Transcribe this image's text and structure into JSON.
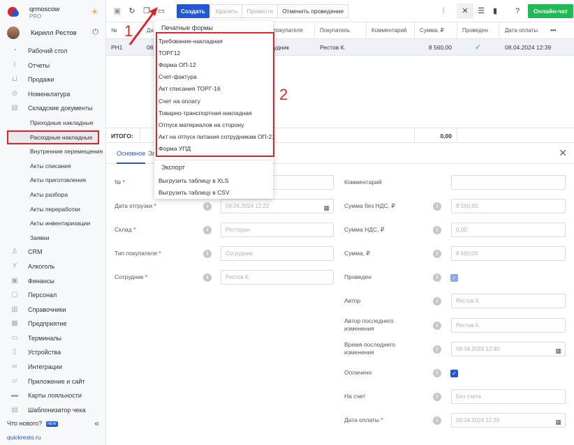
{
  "brand": {
    "name": "qrmoscow",
    "plan": "PRO"
  },
  "user": {
    "name": "Кирилл Рестов"
  },
  "nav": [
    {
      "label": "Рабочий стол",
      "icon": "dashboard-icon",
      "glyph": "◔"
    },
    {
      "label": "Отчеты",
      "icon": "chart-icon",
      "glyph": "⌇"
    },
    {
      "label": "Продажи",
      "icon": "cart-icon",
      "glyph": "⊔"
    },
    {
      "label": "Номенклатура",
      "icon": "tag-icon",
      "glyph": "⊘"
    },
    {
      "label": "Складские документы",
      "icon": "box-icon",
      "glyph": "▤"
    }
  ],
  "subnav": [
    "Приходные накладные",
    "Расходные накладные",
    "Внутренние перемещения",
    "Акты списания",
    "Акты приготовления",
    "Акты разбора",
    "Акты переработки",
    "Акты инвентаризации",
    "Заявки"
  ],
  "nav2": [
    {
      "label": "CRM",
      "icon": "crm-icon",
      "glyph": "♙"
    },
    {
      "label": "Алкоголь",
      "icon": "glass-icon",
      "glyph": "Y"
    },
    {
      "label": "Финансы",
      "icon": "wallet-icon",
      "glyph": "▣"
    },
    {
      "label": "Персонал",
      "icon": "staff-icon",
      "glyph": "▢"
    },
    {
      "label": "Справочники",
      "icon": "book-icon",
      "glyph": "▥"
    },
    {
      "label": "Предприятие",
      "icon": "building-icon",
      "glyph": "▦"
    },
    {
      "label": "Терминалы",
      "icon": "terminal-icon",
      "glyph": "▭"
    },
    {
      "label": "Устройства",
      "icon": "device-icon",
      "glyph": "▯"
    },
    {
      "label": "Интеграции",
      "icon": "link-icon",
      "glyph": "∞"
    },
    {
      "label": "Приложение и сайт",
      "icon": "app-icon",
      "glyph": "▱"
    },
    {
      "label": "Карты лояльности",
      "icon": "card-icon",
      "glyph": "▬"
    },
    {
      "label": "Шаблонизатор чека",
      "icon": "receipt-icon",
      "glyph": "▤"
    }
  ],
  "side_footer": {
    "whats_new": "Что нового?",
    "badge": "NEW",
    "link": "quickresto.ru"
  },
  "toolbar": {
    "create": "Создать",
    "delete": "Удалить",
    "post": "Провести",
    "unpost": "Отменить проведение",
    "chat": "Онлайн-чат"
  },
  "table": {
    "headers": [
      "№",
      "Да",
      "покупателя",
      "Покупатель",
      "Комментарий",
      "Сумма, ₽",
      "Проведен",
      "Дата оплаты"
    ],
    "row": {
      "num": "РН1",
      "date": "08",
      "buyer_type": "удник",
      "buyer": "Рестов К.",
      "comment": "",
      "sum": "8 560,00",
      "date_paid": "08.04.2024 12:39"
    },
    "totals_label": "ИТОГО:",
    "totals_sum": "0,00"
  },
  "form": {
    "tab_main": "Основное",
    "tab_second": "Эл",
    "left": [
      {
        "label": "№",
        "required": "*",
        "value": ""
      },
      {
        "label": "Дата отгрузки",
        "required": "*",
        "value": "08.04.2024 12:22"
      },
      {
        "label": "Склад",
        "required": "*",
        "value": "Ресторан"
      },
      {
        "label": "Тип покупателя",
        "required": "*",
        "value": "Сотрудник"
      },
      {
        "label": "Сотрудник",
        "required": "*",
        "value": "Рестов К."
      }
    ],
    "right": [
      {
        "label": "Комментарий",
        "value": ""
      },
      {
        "label": "Сумма без НДС, ₽",
        "value": "8 560,00"
      },
      {
        "label": "Сумма НДС, ₽",
        "value": "0,00"
      },
      {
        "label": "Сумма, ₽",
        "value": "8 560,00"
      },
      {
        "label": "Проведен",
        "value": ""
      },
      {
        "label": "Автор",
        "value": "Рестов К."
      },
      {
        "label": "Автор последнего изменения",
        "value": "Рестов К."
      },
      {
        "label": "Время последнего изменения",
        "value": "08.04.2024 12:40"
      },
      {
        "label": "Оплачено",
        "value": ""
      },
      {
        "label": "На счет",
        "value": "Без счета"
      },
      {
        "label": "Дата оплаты",
        "required": "*",
        "value": "08.04.2024 12:39"
      }
    ]
  },
  "dropdown": {
    "print_header": "Печатные формы",
    "print_items": [
      "Требование-накладная",
      "ТОРГ12",
      "Форма ОП-12",
      "Счет-фактура",
      "Акт списания ТОРГ-16",
      "Счет на оплату",
      "Товарно-транспортная накладная",
      "Отпуск материалов на сторону",
      "Акт на отпуск питания сотрудникам ОП-21",
      "Форма УПД"
    ],
    "export_header": "Экспорт",
    "export_items": [
      "Выгрузить таблицу в XLS",
      "Выгрузить таблицу в CSV"
    ]
  },
  "annotations": {
    "one": "1",
    "two": "2"
  },
  "colors": {
    "accent": "#2457d6",
    "chat": "#1fba55",
    "annotation": "#e02424"
  }
}
